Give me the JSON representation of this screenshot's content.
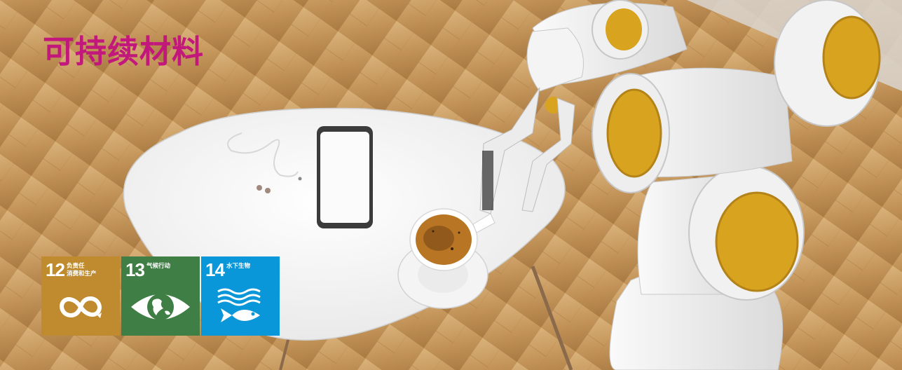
{
  "banner": {
    "title": "可持续材料",
    "title_color": "#c2177b",
    "scene_icon": "robot-arm-serving-coffee-illustration"
  },
  "sdg_goals": [
    {
      "number": "12",
      "label": "负责任\n消费和生产",
      "color": "#bf8b2e",
      "icon": "infinity-icon"
    },
    {
      "number": "13",
      "label": "气候行动",
      "color": "#3f7e44",
      "icon": "eye-earth-icon"
    },
    {
      "number": "14",
      "label": "水下生物",
      "color": "#0a97d9",
      "icon": "fish-waves-icon"
    }
  ]
}
